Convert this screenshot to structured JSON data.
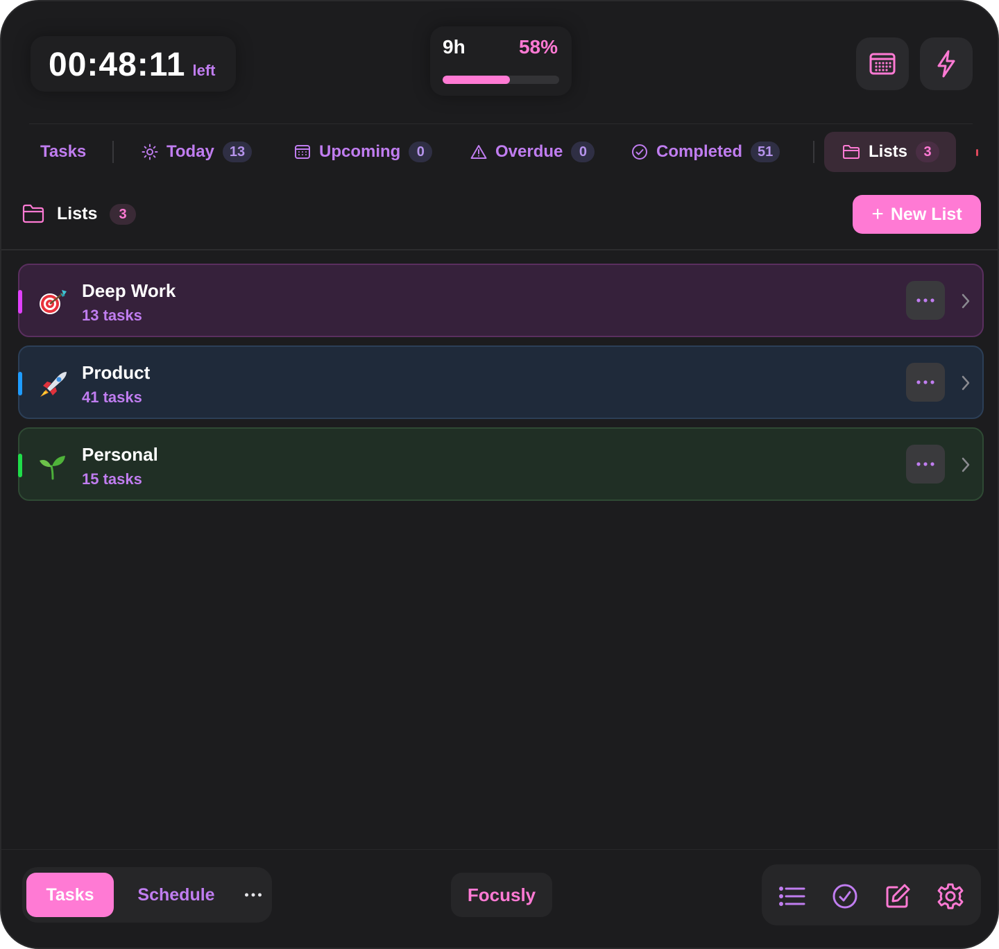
{
  "header": {
    "timer": {
      "value": "00:48:11",
      "suffix": "left"
    },
    "progress": {
      "hours": "9h",
      "percent_label": "58%",
      "fraction": 0.58
    },
    "buttons": {
      "calendar": "calendar-icon",
      "quick_action": "bolt-icon"
    }
  },
  "tabs": [
    {
      "label": "Tasks"
    },
    {
      "label": "Today",
      "count": "13",
      "icon": "sun-icon"
    },
    {
      "label": "Upcoming",
      "count": "0",
      "icon": "calendar-icon"
    },
    {
      "label": "Overdue",
      "count": "0",
      "icon": "warning-icon"
    },
    {
      "label": "Completed",
      "count": "51",
      "icon": "check-circle-icon"
    },
    {
      "label": "Lists",
      "count": "3",
      "icon": "folder-icon",
      "active": true
    }
  ],
  "section": {
    "title": "Lists",
    "count": "3",
    "new_button": {
      "label": "New List"
    }
  },
  "lists": [
    {
      "emoji": "🎯",
      "name": "Deep Work",
      "tasks": "13 tasks",
      "accent": "#e040fb",
      "bg": "#36213b",
      "border": "#5a2f5f"
    },
    {
      "emoji": "🚀",
      "name": "Product",
      "tasks": "41 tasks",
      "accent": "#1e9cff",
      "bg": "#1f2a3a",
      "border": "#2c3f57"
    },
    {
      "emoji": "🌱",
      "name": "Personal",
      "tasks": "15 tasks",
      "accent": "#1fdd4a",
      "bg": "#202f25",
      "border": "#2f4a34"
    }
  ],
  "bottom": {
    "segment": {
      "tasks": "Tasks",
      "schedule": "Schedule"
    },
    "brand": "Focusly",
    "tools": [
      "list-icon",
      "check-circle-icon",
      "edit-icon",
      "gear-icon"
    ]
  },
  "colors": {
    "accent_pink": "#ff7ad4",
    "accent_purple": "#c07df0",
    "background": "#1c1c1e"
  }
}
